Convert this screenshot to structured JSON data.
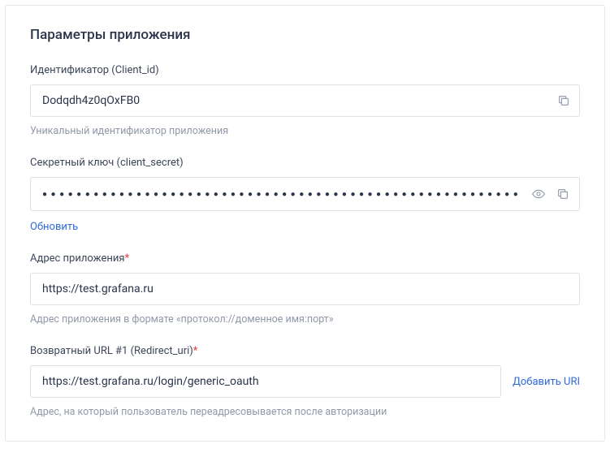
{
  "panel": {
    "title": "Параметры приложения"
  },
  "client_id": {
    "label": "Идентификатор (Client_id)",
    "value": "Dodqdh4z0qOxFB0",
    "help": "Уникальный идентификатор приложения"
  },
  "client_secret": {
    "label": "Секретный ключ (client_secret)",
    "masked": "●●●●●●●●●●●●●●●●●●●●●●●●●●●●●●●●●●●●●●●●●●●●●●●●●●●●●●●●",
    "refresh_label": "Обновить"
  },
  "app_url": {
    "label": "Адрес приложения",
    "value": "https://test.grafana.ru",
    "help": "Адрес приложения в формате «протокол://доменное имя:порт»"
  },
  "redirect_uri": {
    "label": "Возвратный URL #1 (Redirect_uri)",
    "value": "https://test.grafana.ru/login/generic_oauth",
    "add_label": "Добавить URI",
    "help": "Адрес, на который пользователь переадресовывается после авторизации"
  }
}
